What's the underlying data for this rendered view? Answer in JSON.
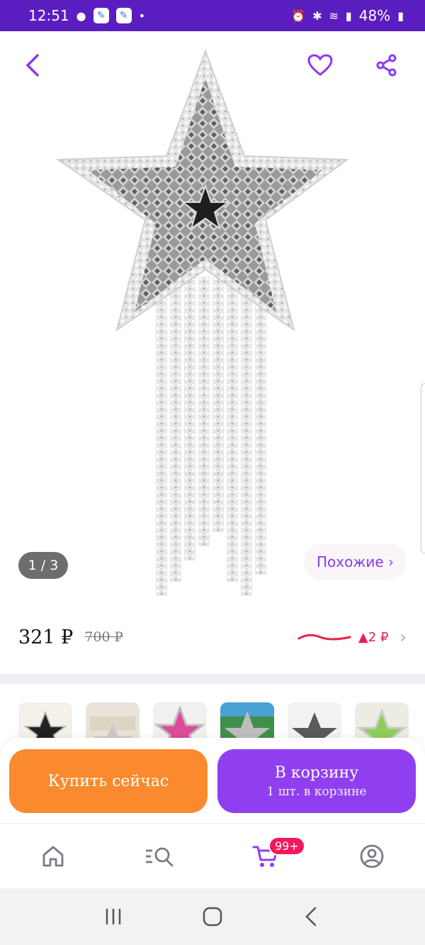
{
  "status_bar": {
    "time": "12:51",
    "battery": "48%",
    "icons": [
      "person-icon",
      "app-icon",
      "app-icon",
      "dot-icon",
      "alarm-icon",
      "bluetooth-icon",
      "wifi-icon",
      "signal-icon",
      "battery-icon"
    ]
  },
  "header": {
    "back_icon": "back-arrow-icon",
    "favorite_icon": "heart-icon",
    "share_icon": "share-icon"
  },
  "gallery": {
    "counter": "1 / 3",
    "similar_label": "Похожие ›"
  },
  "price": {
    "current": "321 ₽",
    "old": "700 ₽",
    "change": "▲2 ₽",
    "accent": "#e8204c"
  },
  "actions": {
    "buy_now": "Купить сейчас",
    "add_to_cart": "В корзину",
    "cart_count_note": "1 шт. в корзине",
    "buy_color": "#fb8a2e",
    "cart_color": "#8f3ff0"
  },
  "tabbar": {
    "cart_badge": "99+",
    "items": [
      "home-icon",
      "catalog-search-icon",
      "cart-icon",
      "profile-icon"
    ]
  },
  "system_nav": {
    "items": [
      "recents-icon",
      "home-icon",
      "back-icon"
    ]
  }
}
